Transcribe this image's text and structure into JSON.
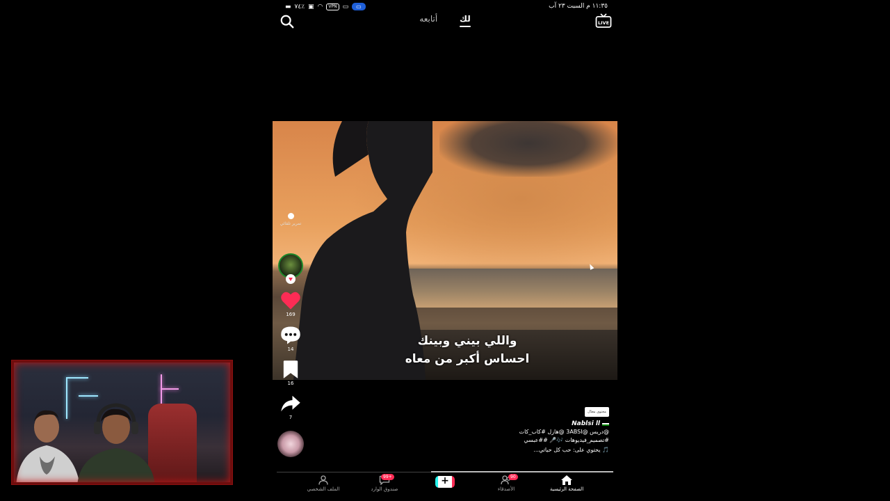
{
  "status_bar": {
    "time_date": "١١:٣٥ م  السبت ٢٣ آب",
    "battery": "٧٤٪",
    "vpn": "VPN"
  },
  "top_nav": {
    "tabs": [
      {
        "label": "أتابعه",
        "active": false
      },
      {
        "label": "لك",
        "active": true
      }
    ],
    "live_label": "LIVE"
  },
  "video": {
    "subtitle_line1": "واللي بيني وبينك",
    "subtitle_line2": "احساس أكبر من معاه"
  },
  "side_rail": {
    "autoscroll_label": "تمرير تلقائي",
    "likes": "169",
    "comments": "14",
    "saves": "16",
    "shares": "7"
  },
  "caption": {
    "promo_tag": "محتوى معدّل",
    "author": "Nablsi ll",
    "line1": "@دريس @3ABSI @هازل #كاب_كات",
    "line2": "#تصميم_فيديوهات 🎶🎤 ##عبسي",
    "music": "🎵 يحتوي على: حب كل حياتي..."
  },
  "bottom_nav": {
    "items": [
      {
        "label": "الصفحة الرئيسية",
        "active": true,
        "icon": "home-icon"
      },
      {
        "label": "الأصدقاء",
        "badge": "90",
        "icon": "friends-icon"
      },
      {
        "label": "صندوق الوارد",
        "badge": "99+",
        "icon": "inbox-icon"
      },
      {
        "label": "الملف الشخصي",
        "icon": "profile-icon"
      }
    ],
    "create_label": "+"
  },
  "colors": {
    "accent_red": "#fe2c55",
    "accent_cyan": "#25f4ee",
    "status_pill": "#1e5fd8"
  }
}
